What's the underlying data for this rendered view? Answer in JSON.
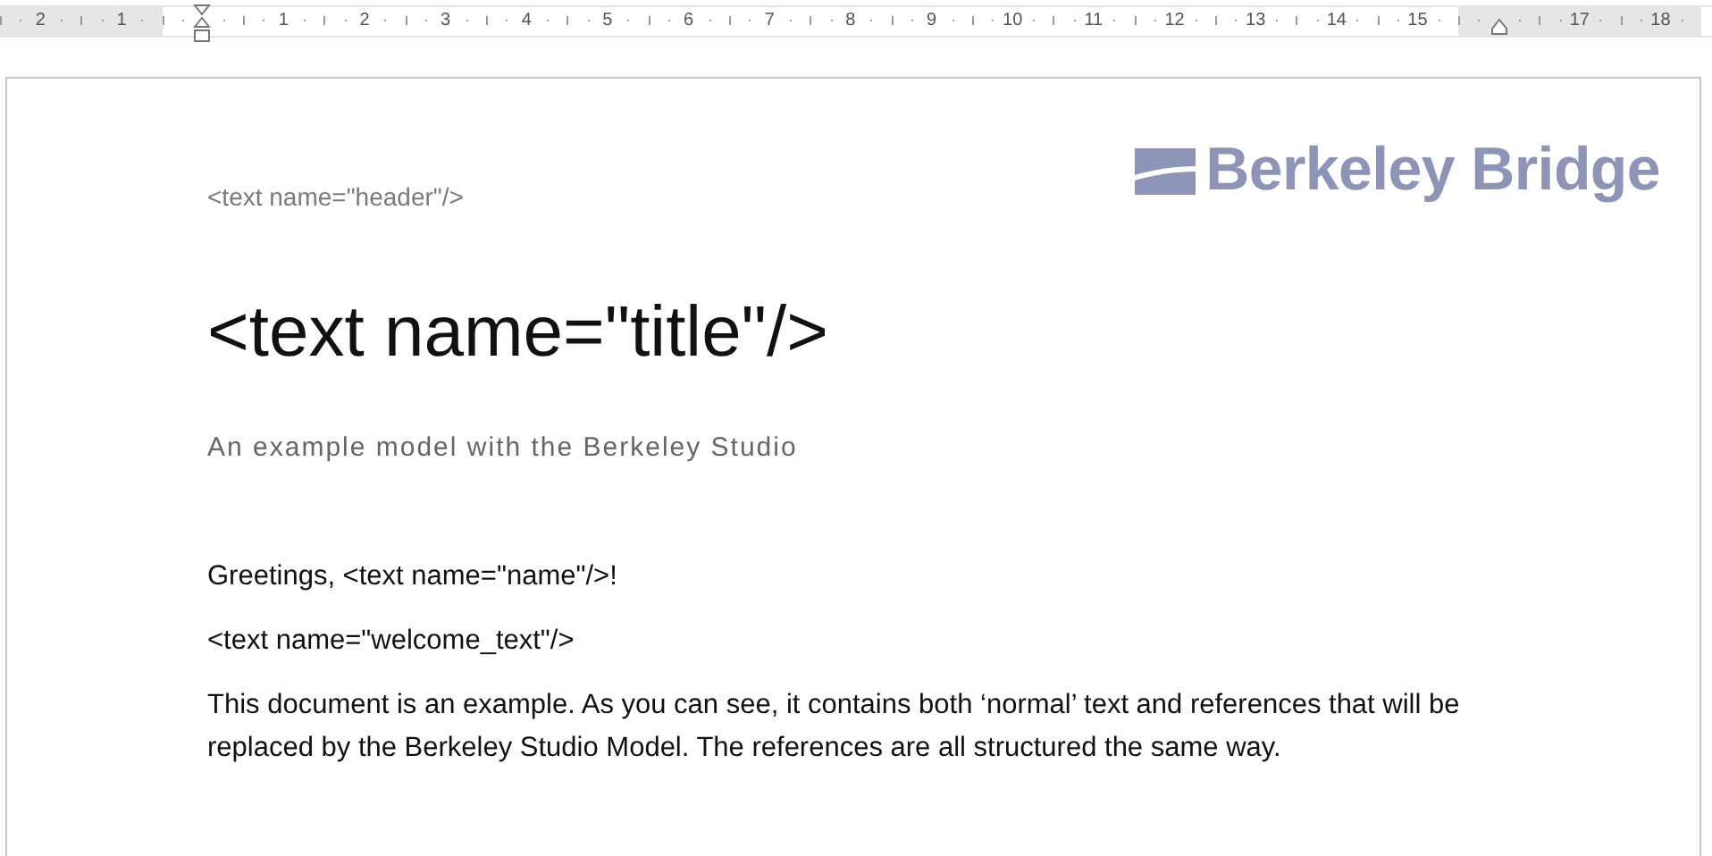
{
  "ruler": {
    "items": [
      {
        "kind": "number",
        "label": "2",
        "margin": true
      },
      {
        "kind": "number",
        "label": "1",
        "margin": true
      },
      {
        "kind": "left-indent",
        "margin": false
      },
      {
        "kind": "number",
        "label": "1",
        "margin": false
      },
      {
        "kind": "number",
        "label": "2",
        "margin": false
      },
      {
        "kind": "number",
        "label": "3",
        "margin": false
      },
      {
        "kind": "number",
        "label": "4",
        "margin": false
      },
      {
        "kind": "number",
        "label": "5",
        "margin": false
      },
      {
        "kind": "number",
        "label": "6",
        "margin": false
      },
      {
        "kind": "number",
        "label": "7",
        "margin": false
      },
      {
        "kind": "number",
        "label": "8",
        "margin": false
      },
      {
        "kind": "number",
        "label": "9",
        "margin": false
      },
      {
        "kind": "number",
        "label": "10",
        "margin": false
      },
      {
        "kind": "number",
        "label": "11",
        "margin": false
      },
      {
        "kind": "number",
        "label": "12",
        "margin": false
      },
      {
        "kind": "number",
        "label": "13",
        "margin": false
      },
      {
        "kind": "number",
        "label": "14",
        "margin": false
      },
      {
        "kind": "number",
        "label": "15",
        "margin": false
      },
      {
        "kind": "right-indent",
        "margin": true
      },
      {
        "kind": "number",
        "label": "17",
        "margin": true
      },
      {
        "kind": "number",
        "label": "18",
        "margin": true
      }
    ]
  },
  "document": {
    "logo": {
      "text": "Berkeley Bridge"
    },
    "header": "<text name=\"header\"/>",
    "title": "<text name=\"title\"/>",
    "subtitle": "An example model with the Berkeley Studio",
    "paragraphs": [
      "Greetings, <text name=\"name\"/>!",
      "<text name=\"welcome_text\"/>",
      "This document is an example. As you can see, it contains both ‘normal’ text and references that will be replaced by the Berkeley Studio Model. The references are all structured the same way."
    ]
  }
}
